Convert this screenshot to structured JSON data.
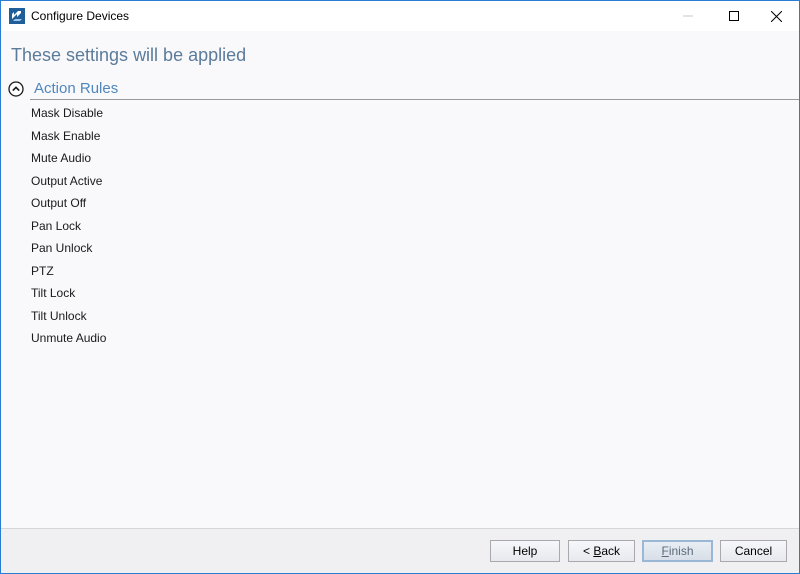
{
  "window": {
    "title": "Configure Devices"
  },
  "main": {
    "heading": "These settings will be applied",
    "section": {
      "title": "Action Rules",
      "items": [
        "Mask Disable",
        "Mask Enable",
        "Mute Audio",
        "Output Active",
        "Output Off",
        "Pan Lock",
        "Pan Unlock",
        "PTZ",
        "Tilt Lock",
        "Tilt Unlock",
        "Unmute Audio"
      ]
    }
  },
  "footer": {
    "help_label": "Help",
    "back_prefix": "< ",
    "back_accel": "B",
    "back_rest": "ack",
    "finish_accel": "F",
    "finish_rest": "inish",
    "cancel_label": "Cancel"
  },
  "colors": {
    "heading": "#5b7b9a",
    "section_title": "#4f87bd",
    "window_border": "#2b7cd3"
  },
  "icons": {
    "app": "configure-devices-app-icon",
    "minimize": "minimize-icon",
    "maximize": "maximize-icon",
    "close": "close-icon",
    "collapse": "chevron-up-circle-icon"
  }
}
